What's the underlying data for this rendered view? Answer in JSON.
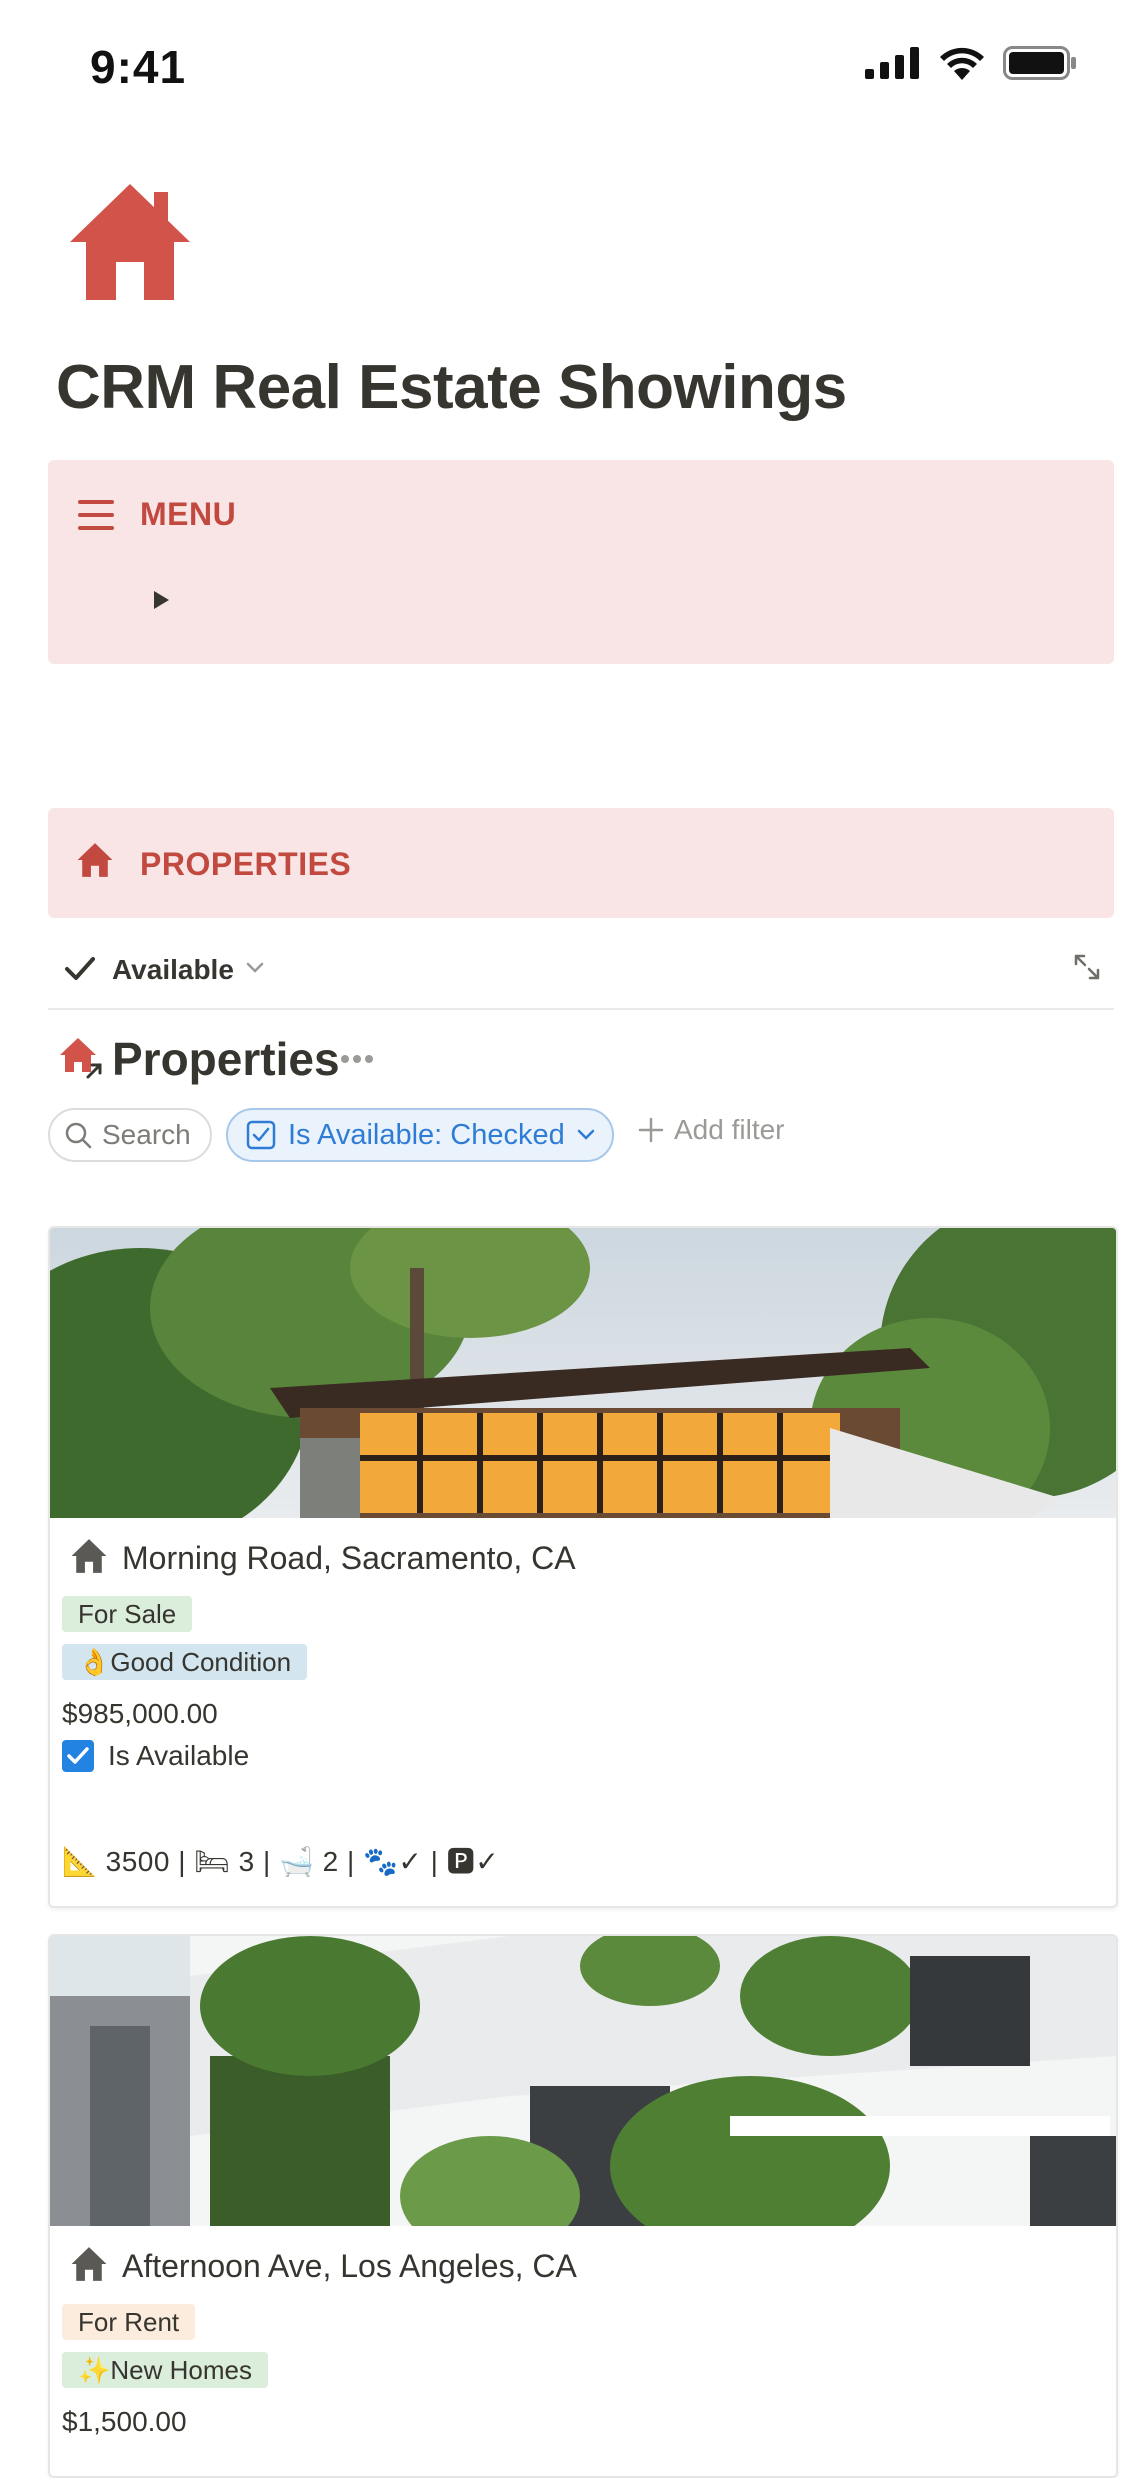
{
  "status_bar": {
    "time": "9:41"
  },
  "page": {
    "title": "CRM Real Estate Showings",
    "icon": "house-icon"
  },
  "menu_callout": {
    "label": "MENU",
    "icon": "hamburger-menu-icon",
    "toggle_icon": "triangle-right-icon"
  },
  "properties_callout": {
    "label": "PROPERTIES",
    "icon": "house-icon"
  },
  "view": {
    "name": "Available"
  },
  "database": {
    "title": "Properties",
    "icon": "house-link-icon"
  },
  "filters": {
    "search_label": "Search",
    "active_filter": "Is Available: Checked",
    "add_filter_label": "Add filter"
  },
  "cards": [
    {
      "title": "Morning Road, Sacramento, CA",
      "status_tag": "For Sale",
      "condition_tag": "👌Good Condition",
      "price": "$985,000.00",
      "available_label": "Is Available",
      "details": "📐 3500  |  🛏 3 | 🛁 2 | 🐾✓ | 🅿✓"
    },
    {
      "title": "Afternoon Ave, Los Angeles, CA",
      "status_tag": "For Rent",
      "condition_tag": "✨New Homes",
      "price": "$1,500.00"
    }
  ],
  "colors": {
    "accent": "#c2493f",
    "callout_bg": "#f9e5e5",
    "filter_blue": "#2e7cd6",
    "tag_green": "#dbeddb",
    "tag_blue": "#d3e5ef",
    "tag_orange": "#fbecdd"
  }
}
